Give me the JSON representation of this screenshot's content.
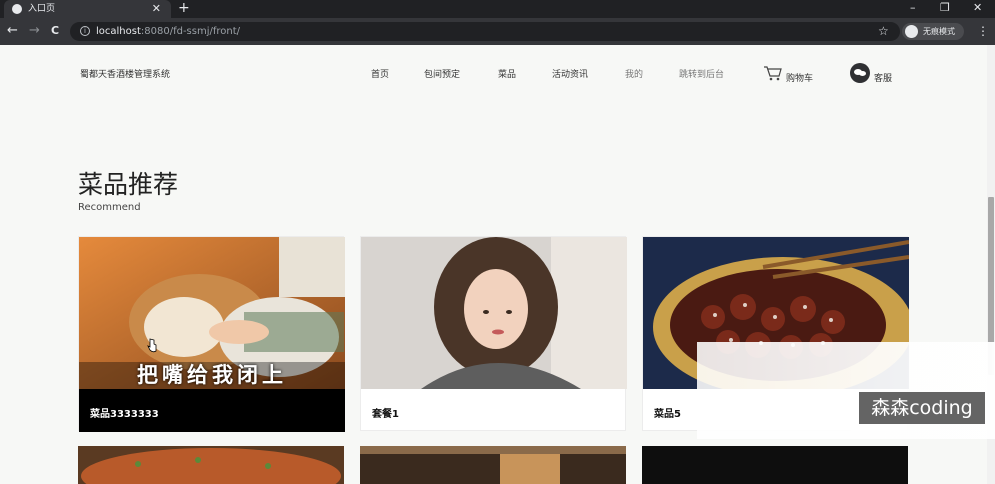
{
  "browser": {
    "tab_title": "入口页",
    "tab_close": "✕",
    "new_tab": "+",
    "url_host": "localhost",
    "url_rest": ":8080/fd-ssmj/front/",
    "incognito_label": "无痕模式",
    "minimize": "–",
    "restore": "❐",
    "close": "✕",
    "back": "←",
    "forward": "→",
    "reload": "C",
    "star": "☆",
    "menu": "⋮",
    "info": "i"
  },
  "header": {
    "brand": "蜀都天香酒楼管理系统",
    "nav": {
      "home": "首页",
      "booking": "包间预定",
      "dishes": "菜品",
      "news": "活动资讯",
      "mine": "我的",
      "admin": "跳转到后台",
      "cart": "购物车",
      "service": "客服"
    }
  },
  "section": {
    "title": "菜品推荐",
    "subtitle": "Recommend"
  },
  "cards": [
    {
      "name": "菜品3333333",
      "image_caption": "把嘴给我闭上"
    },
    {
      "name": "套餐1"
    },
    {
      "name": "菜品5"
    }
  ],
  "watermark": "森森coding",
  "icons": [
    "globe-icon",
    "cart-icon",
    "wechat-icon",
    "star-icon",
    "incognito-icon",
    "menu-icon",
    "cursor-icon"
  ]
}
